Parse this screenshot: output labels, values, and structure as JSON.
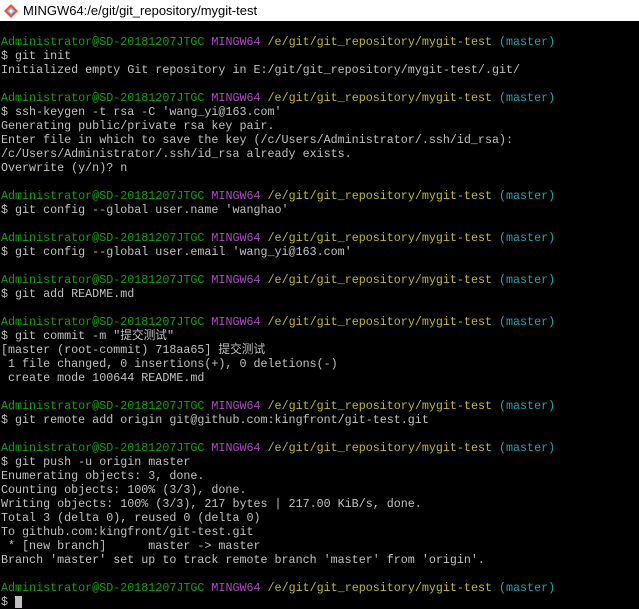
{
  "window": {
    "title": "MINGW64:/e/git/git_repository/mygit-test"
  },
  "colors": {
    "user": "#13a10e",
    "system": "#b148c6",
    "path": "#c1b82b",
    "branch": "#1fa3b3",
    "text": "#c0c0c0"
  },
  "prompt": {
    "user": "Administrator@SD-20181207JTGC",
    "system": "MINGW64",
    "path": "/e/git/git_repository/mygit-test",
    "branch": "(master)"
  },
  "lines": [
    {
      "t": ""
    },
    {
      "p": 1
    },
    {
      "t": "$ git init"
    },
    {
      "t": "Initialized empty Git repository in E:/git/git_repository/mygit-test/.git/"
    },
    {
      "t": ""
    },
    {
      "p": 1
    },
    {
      "t": "$ ssh-keygen -t rsa -C 'wang_yi@163.com'"
    },
    {
      "t": "Generating public/private rsa key pair."
    },
    {
      "t": "Enter file in which to save the key (/c/Users/Administrator/.ssh/id_rsa):"
    },
    {
      "t": "/c/Users/Administrator/.ssh/id_rsa already exists."
    },
    {
      "t": "Overwrite (y/n)? n"
    },
    {
      "t": ""
    },
    {
      "p": 1
    },
    {
      "t": "$ git config --global user.name 'wanghao'"
    },
    {
      "t": ""
    },
    {
      "p": 1
    },
    {
      "t": "$ git config --global user.email 'wang_yi@163.com'"
    },
    {
      "t": ""
    },
    {
      "p": 1
    },
    {
      "t": "$ git add README.md"
    },
    {
      "t": ""
    },
    {
      "p": 1
    },
    {
      "t": "$ git commit -m \"提交测试\""
    },
    {
      "t": "[master (root-commit) 718aa65] 提交测试"
    },
    {
      "t": " 1 file changed, 0 insertions(+), 0 deletions(-)"
    },
    {
      "t": " create mode 100644 README.md"
    },
    {
      "t": ""
    },
    {
      "p": 1
    },
    {
      "t": "$ git remote add origin git@github.com:kingfront/git-test.git"
    },
    {
      "t": ""
    },
    {
      "p": 1
    },
    {
      "t": "$ git push -u origin master"
    },
    {
      "t": "Enumerating objects: 3, done."
    },
    {
      "t": "Counting objects: 100% (3/3), done."
    },
    {
      "t": "Writing objects: 100% (3/3), 217 bytes | 217.00 KiB/s, done."
    },
    {
      "t": "Total 3 (delta 0), reused 0 (delta 0)"
    },
    {
      "t": "To github.com:kingfront/git-test.git"
    },
    {
      "t": " * [new branch]      master -> master"
    },
    {
      "t": "Branch 'master' set up to track remote branch 'master' from 'origin'."
    },
    {
      "t": ""
    },
    {
      "p": 1
    },
    {
      "t": "$ ",
      "cursor": 1
    }
  ]
}
